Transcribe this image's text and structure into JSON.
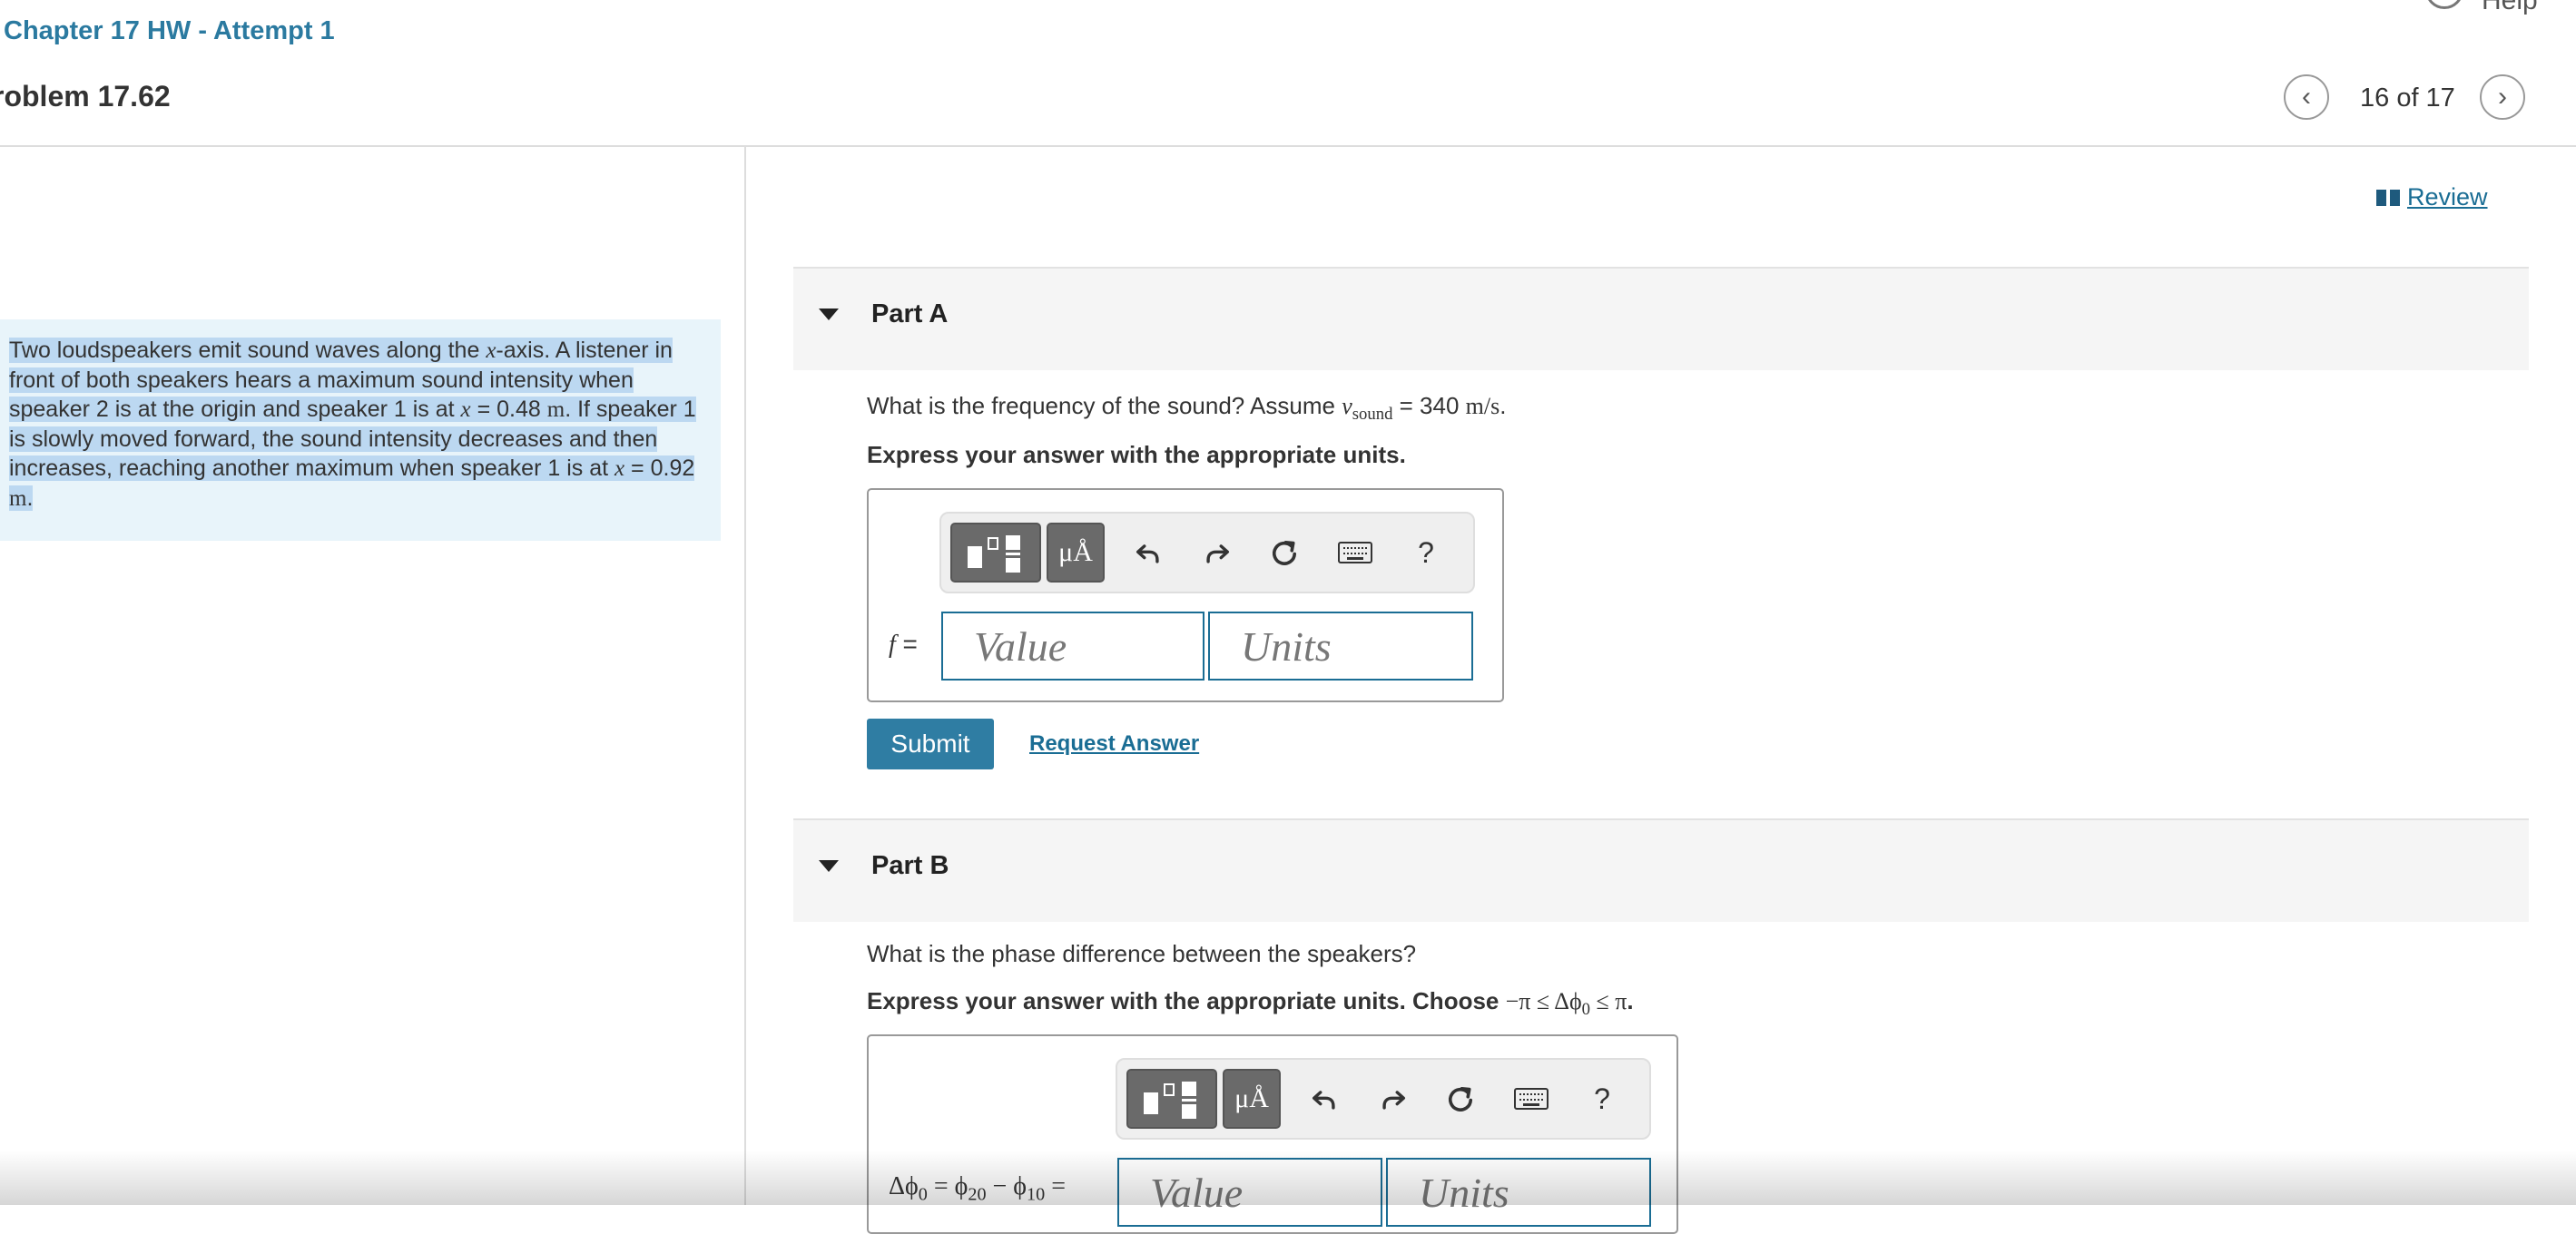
{
  "header": {
    "assignment_title": "Chapter 17 HW - Attempt 1",
    "problem_title": "roblem 17.62",
    "help_label": "Help",
    "page_indicator": "16 of 17",
    "prev_icon": "chevron-left-icon",
    "next_icon": "chevron-right-icon"
  },
  "problem": {
    "text_part1": "Two loudspeakers emit sound waves along the ",
    "x": "x",
    "text_part2": "-axis. A listener in front of both speakers hears a maximum sound intensity when speaker 2 is at the origin and speaker 1 is at ",
    "eq1": " = 0.48 ",
    "unit_m": "m",
    "text_part3": ". If speaker 1 is slowly moved forward, the sound intensity decreases and then increases, reaching another maximum when speaker 1 is at ",
    "eq2": " = 0.92 ",
    "text_part4": "."
  },
  "review_link": "Review",
  "part_a": {
    "title": "Part A",
    "question_pre": "What is the frequency of the sound? Assume ",
    "v": "v",
    "v_sub": "sound",
    "question_eq": " = 340 ",
    "question_unit": "m/s",
    "question_post": ".",
    "instruction": "Express your answer with the appropriate units.",
    "variable_label": "f",
    "equals": " =",
    "value_placeholder": "Value",
    "units_placeholder": "Units",
    "toolbar": {
      "symbols_label": "μÅ",
      "help_label": "?"
    },
    "submit_label": "Submit",
    "request_answer_label": "Request Answer"
  },
  "part_b": {
    "title": "Part B",
    "question": "What is the phase difference between the speakers?",
    "instruction_pre": "Express your answer with the appropriate units. Choose ",
    "instruction_math": "−π ≤ Δϕ",
    "instruction_sub": "0",
    "instruction_math2": " ≤ π",
    "instruction_post": ".",
    "label_delta": "Δϕ",
    "label_sub0": "0",
    "label_eq": " = ϕ",
    "label_sub20": "20",
    "label_minus": " − ϕ",
    "label_sub10": "10",
    "label_end": " =",
    "value_placeholder": "Value",
    "units_placeholder": "Units",
    "toolbar": {
      "symbols_label": "μÅ",
      "help_label": "?"
    }
  },
  "icons": {
    "templates": "templates-icon",
    "undo": "undo-icon",
    "redo": "redo-icon",
    "reset": "reset-icon",
    "keyboard": "keyboard-icon",
    "caret": "caret-down-icon",
    "book": "book-icon"
  },
  "colors": {
    "accent": "#2b7aa0",
    "link": "#1a6d94",
    "submit": "#2f7da3",
    "problem_bg": "#e8f4fa",
    "highlight": "#bcd8f1"
  }
}
